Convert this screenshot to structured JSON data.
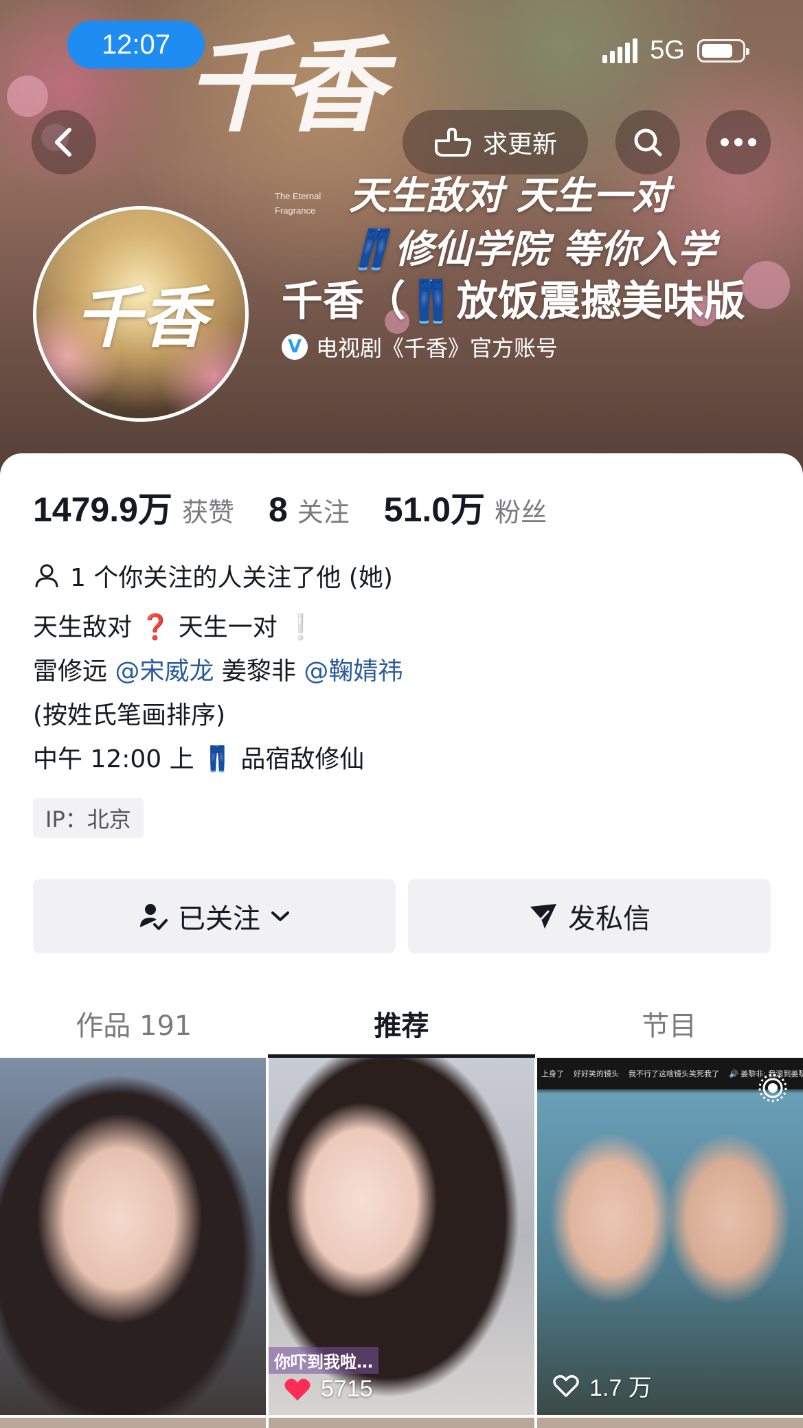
{
  "status_bar": {
    "time": "12:07",
    "network": "5G"
  },
  "nav": {
    "request_update_label": "求更新"
  },
  "banner": {
    "art_title": "千香",
    "art_subtitle_line1": "The Eternal",
    "art_subtitle_line2": "Fragrance",
    "slogan_line1": "天生敌对 天生一对",
    "slogan_line2": "👖修仙学院 等你入学"
  },
  "profile": {
    "avatar_text": "千香",
    "name": "千香（👖放饭震撼美味版",
    "verified_label": "电视剧《千香》官方账号",
    "verified_badge": "V"
  },
  "stats": [
    {
      "value": "1479.9万",
      "label": "获赞"
    },
    {
      "value": "8",
      "label": "关注"
    },
    {
      "value": "51.0万",
      "label": "粉丝"
    }
  ],
  "mutual_follow": "1 个你关注的人关注了他 (她)",
  "bio": {
    "line1_a": "天生敌对 ",
    "line1_q": "❓",
    "line1_b": " 天生一对 ",
    "line1_ex": "❕",
    "line2_a": "雷修远 ",
    "line2_mention1": "@宋威龙",
    "line2_b": " 姜黎非 ",
    "line2_mention2": "@鞠婧祎",
    "line3": "(按姓氏笔画排序)",
    "line4": "中午 12:00 上 👖 品宿敌修仙"
  },
  "ip_tag": "IP：北京",
  "actions": {
    "follow_label": "已关注",
    "message_label": "发私信"
  },
  "tabs": [
    {
      "label": "作品 191",
      "active": false
    },
    {
      "label": "推荐",
      "active": true
    },
    {
      "label": "节目",
      "active": false
    }
  ],
  "thumbnails": [
    {
      "caption": "",
      "likes": ""
    },
    {
      "caption": "你吓到我啦…",
      "likes": "5715"
    },
    {
      "caption": "",
      "likes": "1.7 万",
      "topbar": [
        "上身了",
        "好好笑的镜头",
        "我不行了这啥镜头笑死我了",
        "🔊 姜黎非: 我滚到姜黎非这什么变态"
      ]
    }
  ],
  "colors": {
    "accent_blue": "#1e8cf0",
    "mention_blue": "#2b5b9b",
    "like_red": "#fe2c55"
  }
}
